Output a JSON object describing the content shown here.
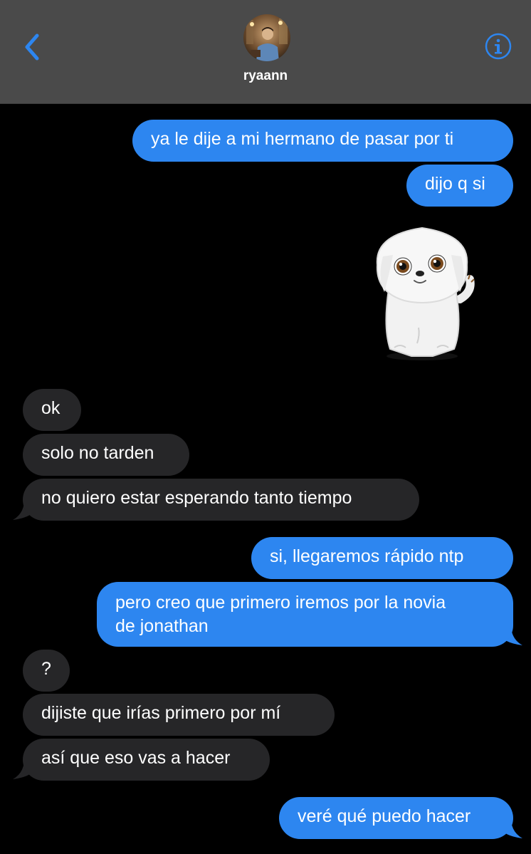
{
  "header": {
    "contact_name": "ryaann",
    "back_icon": "chevron-left-icon",
    "info_icon": "info-circle-icon",
    "accent_color": "#2d86f0",
    "background": "#4a4a4a"
  },
  "conversation": {
    "sent_color": "#2d86f0",
    "received_color": "#262628",
    "messages": [
      {
        "from": "me",
        "text": "ya le dije a mi hermano de pasar por ti"
      },
      {
        "from": "me",
        "text": "dijo q si"
      },
      {
        "from": "me",
        "sticker": "white-puppy-sticker"
      },
      {
        "from": "them",
        "text": "ok"
      },
      {
        "from": "them",
        "text": "solo no tarden"
      },
      {
        "from": "them",
        "text": "no quiero estar esperando tanto tiempo"
      },
      {
        "from": "me",
        "text": "si, llegaremos rápido ntp"
      },
      {
        "from": "me",
        "text_line1": "pero creo que primero iremos por la novia",
        "text_line2": "de jonathan"
      },
      {
        "from": "them",
        "text": "?"
      },
      {
        "from": "them",
        "text": "dijiste que irías primero por mí"
      },
      {
        "from": "them",
        "text": "así que eso vas a hacer"
      },
      {
        "from": "me",
        "text": "veré qué puedo hacer"
      }
    ]
  }
}
